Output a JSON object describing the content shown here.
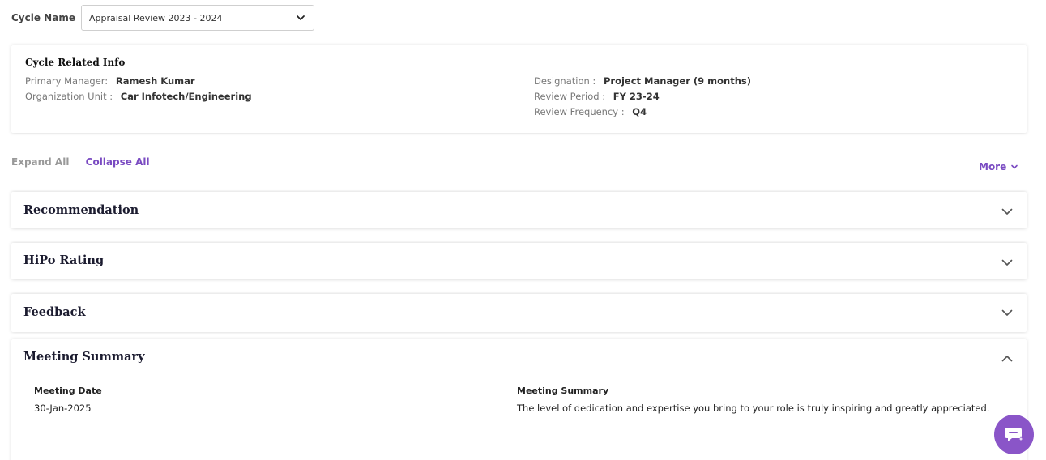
{
  "cycle": {
    "label": "Cycle Name",
    "selected": "Appraisal Review 2023 - 2024"
  },
  "info": {
    "title": "Cycle Related Info",
    "primary_manager_label": "Primary Manager:",
    "primary_manager_value": "Ramesh Kumar",
    "org_unit_label": "Organization Unit :",
    "org_unit_value": "Car Infotech/Engineering",
    "designation_label": "Designation :",
    "designation_value": "Project Manager (9 months)",
    "review_period_label": "Review Period :",
    "review_period_value": "FY 23-24",
    "review_frequency_label": "Review Frequency :",
    "review_frequency_value": "Q4"
  },
  "controls": {
    "expand_all": "Expand All",
    "collapse_all": "Collapse All",
    "more": "More"
  },
  "panels": {
    "recommendation": "Recommendation",
    "hipo": "HiPo Rating",
    "feedback": "Feedback",
    "meeting": "Meeting Summary"
  },
  "meeting": {
    "date_label": "Meeting Date",
    "date_value": "30-Jan-2025",
    "summary_label": "Meeting Summary",
    "summary_value": "The level of dedication and expertise you bring to your role is truly inspiring and greatly appreciated."
  },
  "colors": {
    "accent": "#7a4bc2",
    "fab": "#8a55c8"
  },
  "icons": {
    "select_chevron": "chevron-down-icon",
    "more_chevron": "chevron-down-icon",
    "panel_collapsed": "chevron-down-icon",
    "panel_expanded": "chevron-up-icon",
    "chat": "chat-icon"
  }
}
